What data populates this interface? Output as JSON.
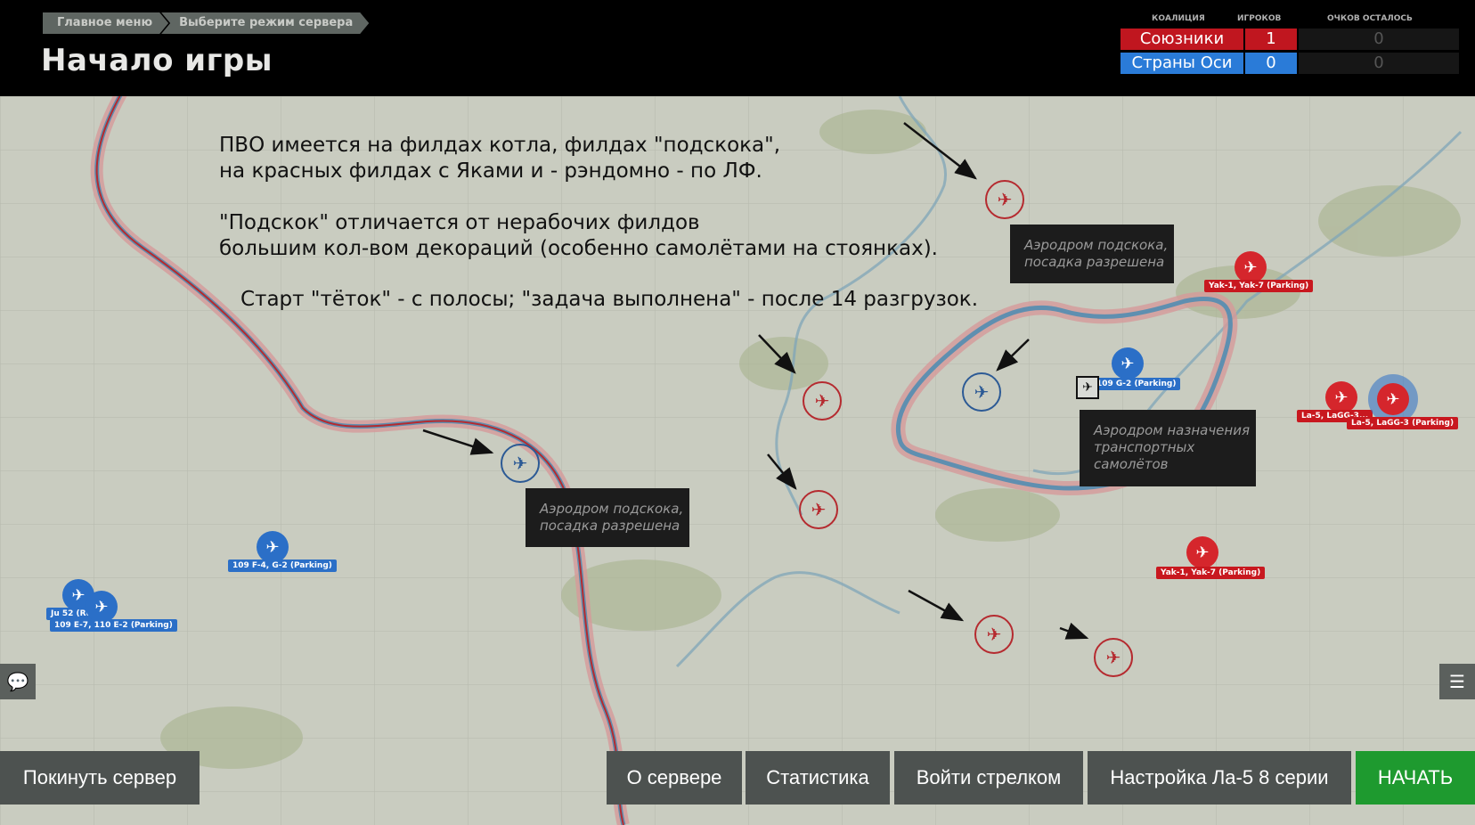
{
  "breadcrumb": {
    "items": [
      "Главное меню",
      "Выберите режим сервера"
    ]
  },
  "page_title": "Начало игры",
  "coalition_table": {
    "headers": {
      "coalition": "КОАЛИЦИЯ",
      "players": "ИГРОКОВ",
      "points": "ОЧКОВ ОСТАЛОСЬ"
    },
    "rows": [
      {
        "name": "Союзники",
        "players": "1",
        "points": "0",
        "color": "#c0161f"
      },
      {
        "name": "Страны Оси",
        "players": "0",
        "points": "0",
        "color": "#2a7bd8"
      }
    ]
  },
  "annotation": {
    "line1": "ПВО имеется на филдах котла, филдах \"подскока\",",
    "line2": "на красных филдах с Яками и - рэндомно - по ЛФ.",
    "line3": "\"Подскок\" отличается от нерабочих филдов",
    "line4": "большим кол-вом декораций (особенно самолётами на стоянках).",
    "line5": "Старт \"тёток\" - с полосы; \"задача выполнена\" - после 14 разгрузок."
  },
  "tooltips": {
    "hop_top": "Аэродром подскока,\nпосадка разрешена",
    "hop_left": "Аэродром подскока,\nпосадка разрешена",
    "transport": "Аэродром назначения\nтранспортных\nсамолётов"
  },
  "airfield_labels": {
    "blue_g2": "109 G-2 (Parking)",
    "blue_f4": "109 F-4, G-2 (Parking)",
    "blue_ju52": "Ju 52 (Run...",
    "blue_e7": "109 E-7, 110 E-2 (Parking)",
    "red_yak_top": "Yak-1, Yak-7 (Parking)",
    "red_la5_a": "La-5, LaGG-3...",
    "red_la5_b": "La-5, LaGG-3 (Parking)",
    "red_yak_bottom": "Yak-1, Yak-7 (Parking)"
  },
  "icons": {
    "airfield": "aircraft-icon",
    "chat": "chat-icon",
    "briefing": "briefing-icon"
  },
  "buttons": {
    "leave": "Покинуть сервер",
    "about": "О сервере",
    "stats": "Статистика",
    "gunner": "Войти стрелком",
    "setup": "Настройка Ла-5 8 серии",
    "start": "НАЧАТЬ"
  },
  "colors": {
    "allies": "#c0161f",
    "axis": "#2a7bd8",
    "start": "#1e9a2f",
    "button": "#4d5250"
  }
}
